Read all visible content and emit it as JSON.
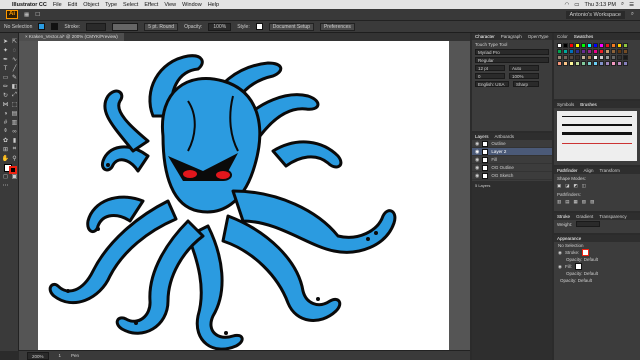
{
  "menubar": {
    "app_name": "Illustrator CC",
    "items": [
      "File",
      "Edit",
      "Object",
      "Type",
      "Select",
      "Effect",
      "View",
      "Window",
      "Help"
    ],
    "clock": "Thu 3:13 PM"
  },
  "appbar": {
    "logo": "Ai",
    "workspace": "Antonio's Workspace"
  },
  "control": {
    "selection": "No Selection",
    "stroke_label": "Stroke:",
    "brush": "5 pt. Round",
    "opacity_label": "Opacity:",
    "opacity": "100%",
    "style_label": "Style:",
    "doc_setup": "Document Setup",
    "preferences": "Preferences"
  },
  "doc": {
    "tab": "Kraken_Vector.ai* @ 200% (CMYK/Preview)",
    "zoom": "200%",
    "artboard_num": "1",
    "status_tool": "Pen"
  },
  "character": {
    "tabs": [
      "Character",
      "Paragraph",
      "OpenType"
    ],
    "touch": "Touch Type Tool",
    "font": "Myriad Pro",
    "style": "Regular",
    "size": "12 pt",
    "leading": "Auto",
    "tracking": "0",
    "kerning": "100%",
    "language": "English: USA",
    "aa": "Sharp"
  },
  "layers": {
    "tabs": [
      "Layers",
      "Artboards"
    ],
    "items": [
      {
        "name": "Outline",
        "selected": false
      },
      {
        "name": "Layer 2",
        "selected": true
      },
      {
        "name": "Fill",
        "selected": false
      },
      {
        "name": "OG Outline",
        "selected": false
      },
      {
        "name": "OG Sketch",
        "selected": false
      }
    ],
    "count": "5 Layers"
  },
  "color": {
    "tabs": [
      "Color",
      "Swatches"
    ]
  },
  "brushes": {
    "tabs": [
      "Symbols",
      "Brushes"
    ]
  },
  "pathfinder": {
    "tabs": [
      "Pathfinder",
      "Align",
      "Transform"
    ],
    "shape_modes": "Shape Modes:",
    "pathfinders": "Pathfinders:"
  },
  "stroke_panel": {
    "tabs": [
      "Stroke",
      "Gradient",
      "Transparency"
    ],
    "weight_label": "Weight:"
  },
  "appearance": {
    "title": "Appearance",
    "selection": "No Selection",
    "stroke": "Stroke:",
    "fill": "Fill:",
    "opacity_default": "Opacity: Default"
  },
  "colors": {
    "octopus_fill": "#2b9be0",
    "octopus_stroke": "#0a0a0a",
    "eye": "#e0161c",
    "accent": "#ff9a00"
  }
}
